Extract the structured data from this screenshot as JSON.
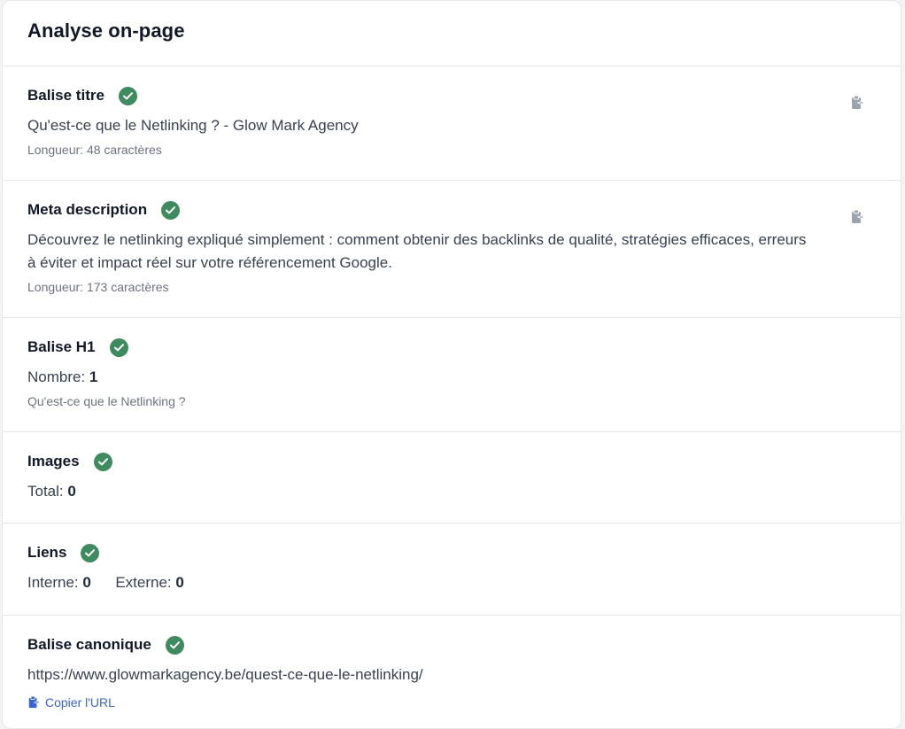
{
  "card": {
    "title": "Analyse on-page"
  },
  "title_tag": {
    "label": "Balise titre",
    "value": "Qu'est-ce que le Netlinking ? - Glow Mark Agency",
    "length": "Longueur: 48 caractères"
  },
  "meta_description": {
    "label": "Meta description",
    "value": "Découvrez le netlinking expliqué simplement : comment obtenir des backlinks de qualité, stratégies efficaces, erreurs à éviter et impact réel sur votre référencement Google.",
    "length": "Longueur: 173 caractères"
  },
  "h1": {
    "label": "Balise H1",
    "count_label": "Nombre:",
    "count": "1",
    "text": "Qu'est-ce que le Netlinking ?"
  },
  "images": {
    "label": "Images",
    "total_label": "Total:",
    "total": "0"
  },
  "links": {
    "label": "Liens",
    "internal_label": "Interne:",
    "internal": "0",
    "external_label": "Externe:",
    "external": "0"
  },
  "canonical": {
    "label": "Balise canonique",
    "url": "https://www.glowmarkagency.be/quest-ce-que-le-netlinking/",
    "copy_label": "Copier l'URL"
  },
  "icons": {
    "status": "check-circle-icon",
    "copy": "clipboard-icon"
  },
  "colors": {
    "success": "#3d8b5f",
    "link": "#3b63d9",
    "copy_icon": "#9ca3af"
  }
}
